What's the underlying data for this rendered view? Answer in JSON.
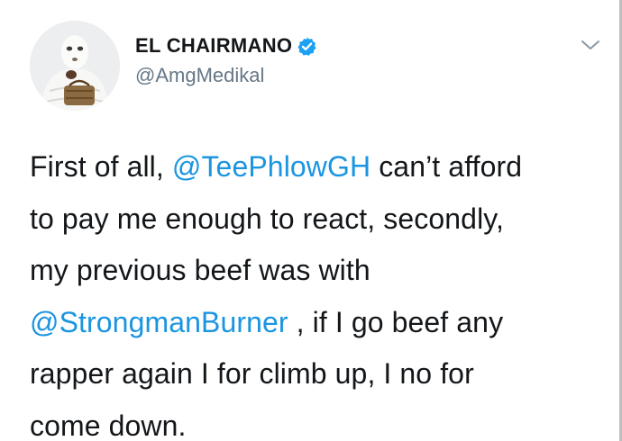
{
  "author": {
    "display_name": "EL CHAIRMANO",
    "handle": "@AmgMedikal",
    "verified": true
  },
  "menu_icon": "chevron-down-icon",
  "tweet": {
    "lines": [
      [
        {
          "text": "First of all, ",
          "mention": false
        },
        {
          "text": "@TeePhlowGH",
          "mention": true
        },
        {
          "text": " can’t afford",
          "mention": false
        }
      ],
      [
        {
          "text": "to pay me enough to react, secondly,",
          "mention": false
        }
      ],
      [
        {
          "text": "my previous beef was with",
          "mention": false
        }
      ],
      [
        {
          "text": "@StrongmanBurner",
          "mention": true
        },
        {
          "text": " , if I go beef any",
          "mention": false
        }
      ],
      [
        {
          "text": "rapper again I for climb up, I no for",
          "mention": false
        }
      ],
      [
        {
          "text": "come down.",
          "mention": false
        }
      ]
    ]
  },
  "colors": {
    "text": "#14171a",
    "secondary": "#657786",
    "link": "#1b95e0",
    "verified_badge": "#1da1f2"
  }
}
